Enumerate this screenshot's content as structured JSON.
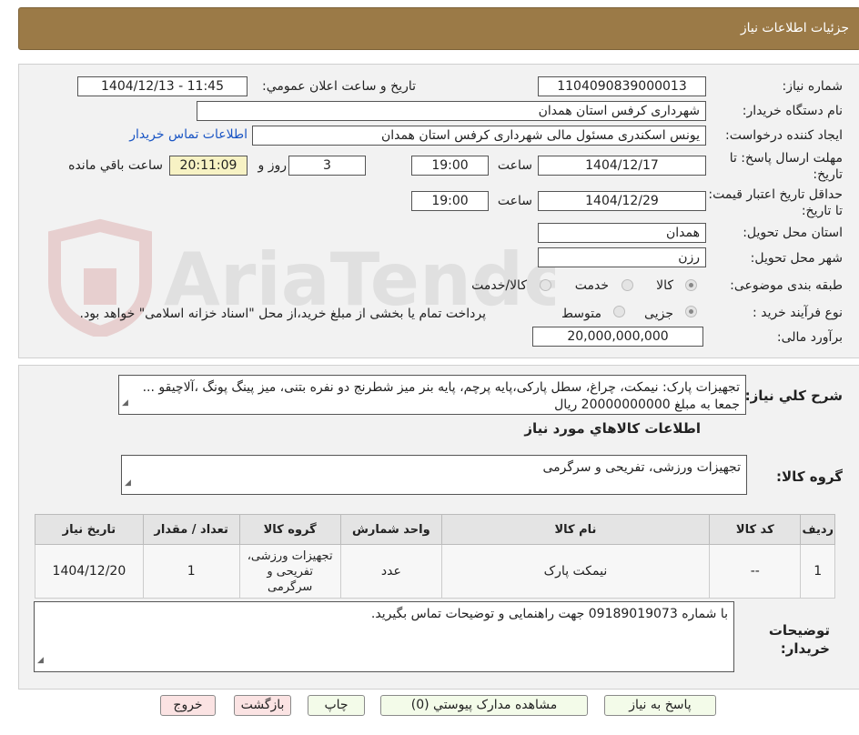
{
  "header": {
    "title": "جزئیات اطلاعات نیاز"
  },
  "watermark": {
    "text": "AriaTender.neT"
  },
  "fields": {
    "need_number_label": "شماره نیاز:",
    "need_number": "1104090839000013",
    "announce_label": "تاریخ و ساعت اعلان عمومي:",
    "announce_value": "1404/12/13 - 11:45",
    "buyer_org_label": "نام دستگاه خریدار:",
    "buyer_org": "شهرداری کرفس استان همدان",
    "requester_label": "ایجاد کننده درخواست:",
    "requester": "یونس اسکندری مسئول مالی شهرداری کرفس استان همدان",
    "contact_link": "اطلاعات تماس خریدار",
    "deadline_label": "مهلت ارسال پاسخ: تا تاریخ:",
    "deadline_date": "1404/12/17",
    "time_label": "ساعت",
    "deadline_time": "19:00",
    "days_value": "3",
    "days_label": "روز و",
    "remaining_time": "20:11:09",
    "remaining_label": "ساعت باقي مانده",
    "validity_label": "حداقل تاریخ اعتبار قیمت: تا تاریخ:",
    "validity_date": "1404/12/29",
    "validity_time": "19:00",
    "province_label": "استان محل تحویل:",
    "province": "همدان",
    "city_label": "شهر محل تحویل:",
    "city": "رزن",
    "category_label": "طبقه بندی موضوعی:",
    "category_options": [
      "کالا",
      "خدمت",
      "کالا/خدمت"
    ],
    "category_selected": "کالا",
    "process_label": "نوع فرآیند خرید :",
    "process_options": [
      "جزیی",
      "متوسط"
    ],
    "process_selected": "جزیی",
    "process_note": "پرداخت تمام یا بخشی از مبلغ خرید،از محل \"اسناد خزانه اسلامی\" خواهد بود.",
    "budget_label": "برآورد مالی:",
    "budget": "20,000,000,000"
  },
  "summary": {
    "label": "شرح کلي نیاز:",
    "text": "تجهیزات پارک: نیمکت، چراغ، سطل پارکی،پایه پرچم، پایه بنر میز شطرنج دو نفره بتنی،  میز پینگ پونگ ،آلاچیقو ... جمعا به مبلغ 20000000000 ریال"
  },
  "goods_section": {
    "title": "اطلاعات کالاهاي مورد نیاز",
    "group_label": "گروه کالا:",
    "group_value": "تجهیزات ورزشی، تفریحی و سرگرمی"
  },
  "table": {
    "headers": [
      "ردیف",
      "کد کالا",
      "نام کالا",
      "واحد شمارش",
      "گروه کالا",
      "تعداد / مقدار",
      "تاریخ نیاز"
    ],
    "rows": [
      [
        "1",
        "--",
        "نیمکت پارک",
        "عدد",
        "تجهیزات ورزشی، تفریحی و سرگرمی",
        "1",
        "1404/12/20"
      ]
    ]
  },
  "notes": {
    "label": "توضیحات خریدار:",
    "text": "با شماره 09189019073 جهت راهنمایی و توضیحات تماس بگیرید."
  },
  "buttons": {
    "reply": "پاسخ به نیاز",
    "attachments": "مشاهده مدارک پیوستي (0)",
    "print": "چاپ",
    "back": "بازگشت",
    "exit": "خروج"
  },
  "colors": {
    "header_bg": "#9b7a47",
    "link": "#1a55c4",
    "highlight": "#f7f2c4"
  }
}
